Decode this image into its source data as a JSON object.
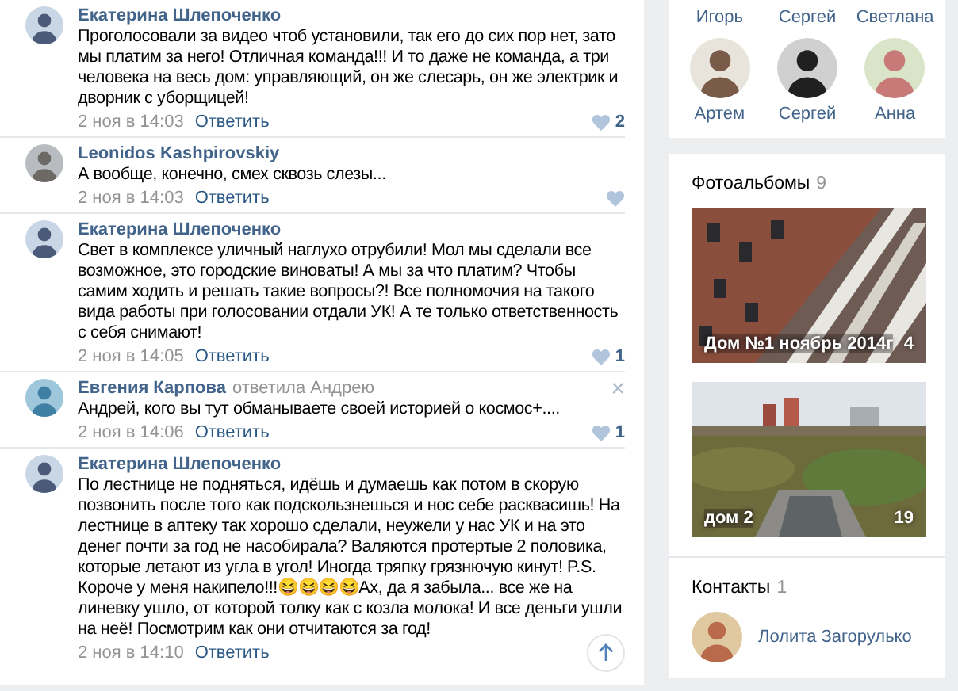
{
  "comments": [
    {
      "author": "Екатерина Шлепоченко",
      "text": "Проголосовали за видео чтоб установили, так его до сих пор нет, зато мы платим за него! Отличная команда!!! И то даже не команда, а три человека на весь дом: управляющий, он же слесарь, он же электрик и дворник с уборщицей!",
      "date": "2 ноя в 14:03",
      "reply_label": "Ответить",
      "like_button": true,
      "likes": "2"
    },
    {
      "author": "Leonidos Kashpirovskiy",
      "text": "А вообще, конечно, смех сквозь слезы...",
      "date": "2 ноя в 14:03",
      "reply_label": "Ответить",
      "like_button": true
    },
    {
      "author": "Екатерина Шлепоченко",
      "text": "Свет в комплексе уличный наглухо отрубили! Мол мы сделали все возможное, это городские виноваты! А мы за что платим? Чтобы самим ходить и решать такие вопросы?! Все полномочия на такого вида работы при голосовании отдали УК! А те только ответственность с себя снимают!",
      "date": "2 ноя в 14:05",
      "reply_label": "Ответить",
      "like_button": true,
      "likes": "1"
    },
    {
      "author": "Евгения Карпова",
      "reply_to": "ответила Андрею",
      "close": "×",
      "text": "Андрей, кого вы тут обманываете своей историей о космос+....",
      "date": "2 ноя в 14:06",
      "reply_label": "Ответить",
      "like_button": true,
      "likes": "1"
    },
    {
      "author": "Екатерина Шлепоченко",
      "text": "По лестнице не подняться, идёшь и думаешь как потом в скорую позвонить после того как подскользнешься и нос себе расквасишь! На лестнице в аптеку так хорошо сделали, неужели у нас УК и на это денег почти за год не насобирала? Валяются протертые 2 половика, которые летают из угла в угол! Иногда тряпку грязнючую кинут! P.S. Короче у меня накипело!!!😆😆😆😆Ах, да я забыла... все же на линевку ушло, от которой толку как с козла молока! И все деньги ушли на неё! Посмотрим как они отчитаются за год!",
      "date": "2 ноя в 14:10",
      "reply_label": "Ответить",
      "like_button": false
    }
  ],
  "scroll_up_button": true,
  "friends": {
    "cut_names": [
      "Игорь",
      "Сергей",
      "Светлана"
    ],
    "people": [
      {
        "name": "Артем"
      },
      {
        "name": "Сергей"
      },
      {
        "name": "Анна"
      }
    ]
  },
  "photo_albums": {
    "title": "Фотоальбомы",
    "count": "9",
    "items": [
      {
        "title": "Дом №1 ноябрь 2014г",
        "count": "4"
      },
      {
        "title": "дом 2",
        "count": "19"
      }
    ]
  },
  "contacts": {
    "title": "Контакты",
    "count": "1",
    "items": [
      {
        "name": "Лолита Загорулько"
      }
    ]
  }
}
